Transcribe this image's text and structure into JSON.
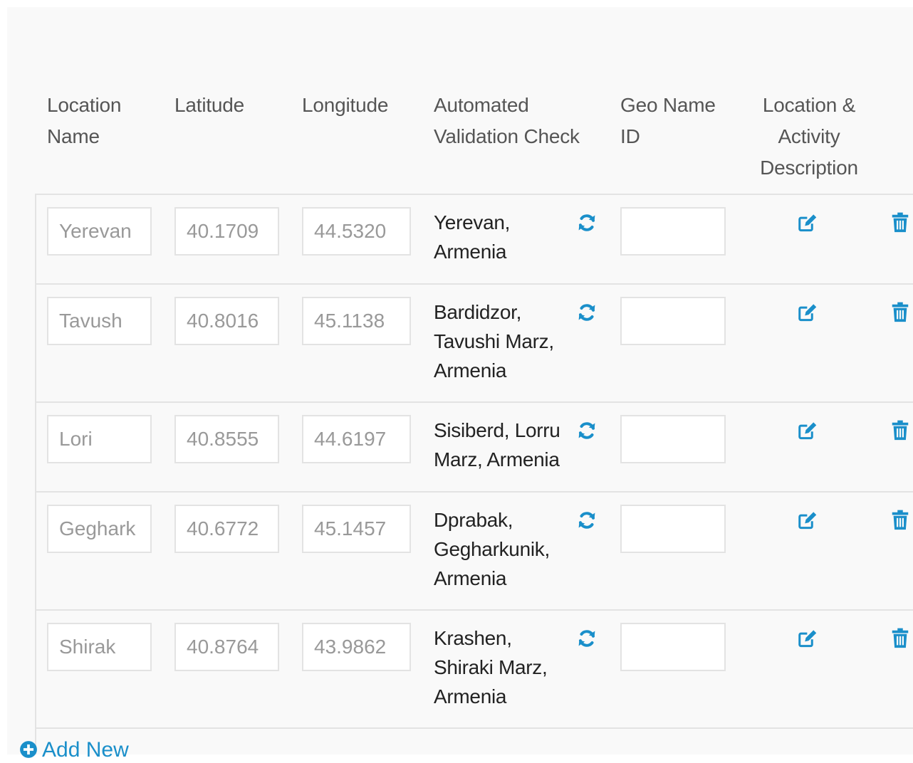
{
  "table": {
    "headers": {
      "location_name": "Location\nName",
      "latitude": "Latitude",
      "longitude": "Longitude",
      "validation": "Automated\nValidation Check",
      "geo_name_id": "Geo Name\nID",
      "description": "Location &\nActivity\nDescription"
    },
    "rows": [
      {
        "location_name": "Yerevan",
        "latitude": "40.1709",
        "longitude": "44.5320",
        "validation": "Yerevan,\nArmenia",
        "geo_name_id": ""
      },
      {
        "location_name": "Tavush",
        "latitude": "40.8016",
        "longitude": "45.1138",
        "validation": "Bardidzor,\nTavushi Marz,\nArmenia",
        "geo_name_id": ""
      },
      {
        "location_name": "Lori",
        "latitude": "40.8555",
        "longitude": "44.6197",
        "validation": "Sisiberd, Lorru\nMarz, Armenia",
        "geo_name_id": ""
      },
      {
        "location_name": "Geghark",
        "latitude": "40.6772",
        "longitude": "45.1457",
        "validation": "Dprabak,\nGegharkunik,\nArmenia",
        "geo_name_id": ""
      },
      {
        "location_name": "Shirak",
        "latitude": "40.8764",
        "longitude": "43.9862",
        "validation": "Krashen,\nShiraki Marz,\nArmenia",
        "geo_name_id": ""
      }
    ],
    "icons": {
      "refresh": "refresh-icon",
      "edit": "edit-icon",
      "delete": "trash-icon",
      "add": "plus-circle-icon"
    }
  },
  "add_new": {
    "label": "Add New"
  },
  "colors": {
    "accent": "#1a8fca",
    "header_text": "#555555",
    "body_text": "#222222",
    "placeholder_text": "#999999",
    "border": "#e3e3e3",
    "background": "#f9f9f9"
  }
}
